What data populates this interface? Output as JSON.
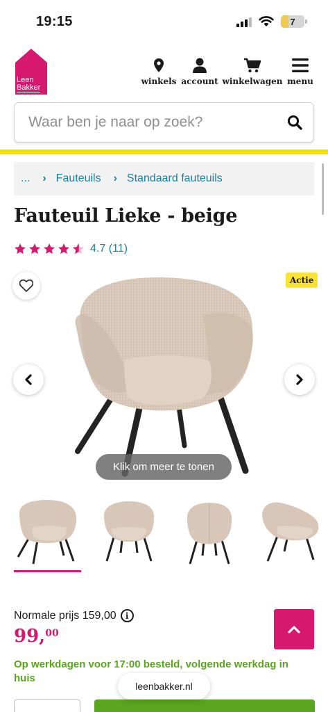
{
  "status_bar": {
    "time": "19:15",
    "battery": "7"
  },
  "header": {
    "logo_line1": "Leen",
    "logo_line2": "Bakker",
    "nav": [
      {
        "label": "winkels",
        "icon": "location-pin-icon"
      },
      {
        "label": "account",
        "icon": "user-icon"
      },
      {
        "label": "winkelwagen",
        "icon": "cart-icon"
      },
      {
        "label": "menu",
        "icon": "hamburger-icon"
      }
    ]
  },
  "search": {
    "placeholder": "Waar ben je naar op zoek?",
    "value": ""
  },
  "breadcrumb": [
    "...",
    "Fauteuils",
    "Standaard fauteuils"
  ],
  "product": {
    "title": "Fauteuil Lieke - beige",
    "rating_value": 4.7,
    "rating_text": "4.7 (11)",
    "badge": "Actie",
    "gallery_hint": "Klik om meer te tonen",
    "thumbnail_count": 4,
    "active_thumbnail": 1
  },
  "price": {
    "normal_label": "Normale prijs 159,00",
    "info_icon": "i",
    "current_main": "99,",
    "current_cents": "00"
  },
  "delivery": "Op werkdagen voor 17:00 besteld, volgende werkdag in huis",
  "browser": {
    "url": "leenbakker.nl"
  },
  "colors": {
    "brand_pink": "#d6196e",
    "accent_yellow": "#f5e100",
    "link_teal": "#1a7f9c",
    "success_green": "#5aa61e"
  }
}
